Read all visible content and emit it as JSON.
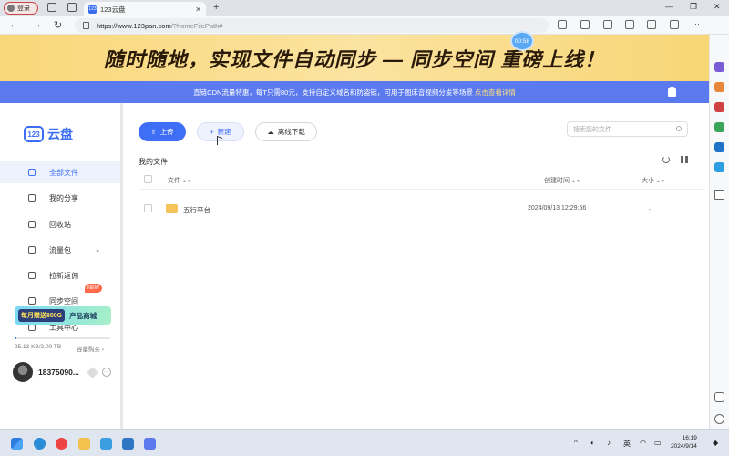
{
  "browser": {
    "profile_label": "登录",
    "tab_title": "123云盘",
    "tab_favicon": "123",
    "url_host": "https://www.123pan.com",
    "url_path": "/?homeFilePath#",
    "timer": "00:58"
  },
  "banner": {
    "headline": "随时随地，实现文件自动同步 — 同步空间 重磅上线！"
  },
  "notice": {
    "text": "直链CDN流量特惠，每T只需80元，支持自定义域名和防盗链，可用于图床音视频分发等场景",
    "link": "点击查看详情"
  },
  "sidebar": {
    "logo_mark": "123",
    "logo_text": "云盘",
    "items": [
      {
        "label": "全部文件",
        "icon": "folder-icon",
        "active": true
      },
      {
        "label": "我的分享",
        "icon": "share-icon",
        "active": false
      },
      {
        "label": "回收站",
        "icon": "trash-icon",
        "active": false
      },
      {
        "label": "流量包",
        "icon": "traffic-icon",
        "active": false,
        "chevron": "⌄"
      },
      {
        "label": "拉新返佣",
        "icon": "coin-icon",
        "active": false
      },
      {
        "label": "同步空间",
        "icon": "sync-icon",
        "active": false
      },
      {
        "label": "工具中心",
        "icon": "toolbox-icon",
        "active": false
      }
    ],
    "new_badge": "NEW",
    "promo_left": "每月赠送800G",
    "promo_right": "产品商城",
    "storage_text": "95.13 KB/2.00 TB",
    "storage_fraction": 0.01,
    "expand_label": "容量购买",
    "username": "18375090..."
  },
  "toolbar": {
    "upload_label": "上传",
    "new_label": "新建",
    "offline_label": "离线下载",
    "search_placeholder": "搜索您的文件"
  },
  "files": {
    "breadcrumb": "我的文件",
    "columns": {
      "name": "文件",
      "created": "创建时间",
      "size": "大小"
    },
    "rows": [
      {
        "name": "五行平台",
        "created": "2024/09/13 12:29:56",
        "size": "-"
      }
    ]
  },
  "taskbar": {
    "ime": "英",
    "time": "16:19",
    "date": "2024/9/14"
  },
  "colors": {
    "accent": "#3d6ef5",
    "notice_bg": "#5b7af0",
    "banner": "#f9d779"
  }
}
